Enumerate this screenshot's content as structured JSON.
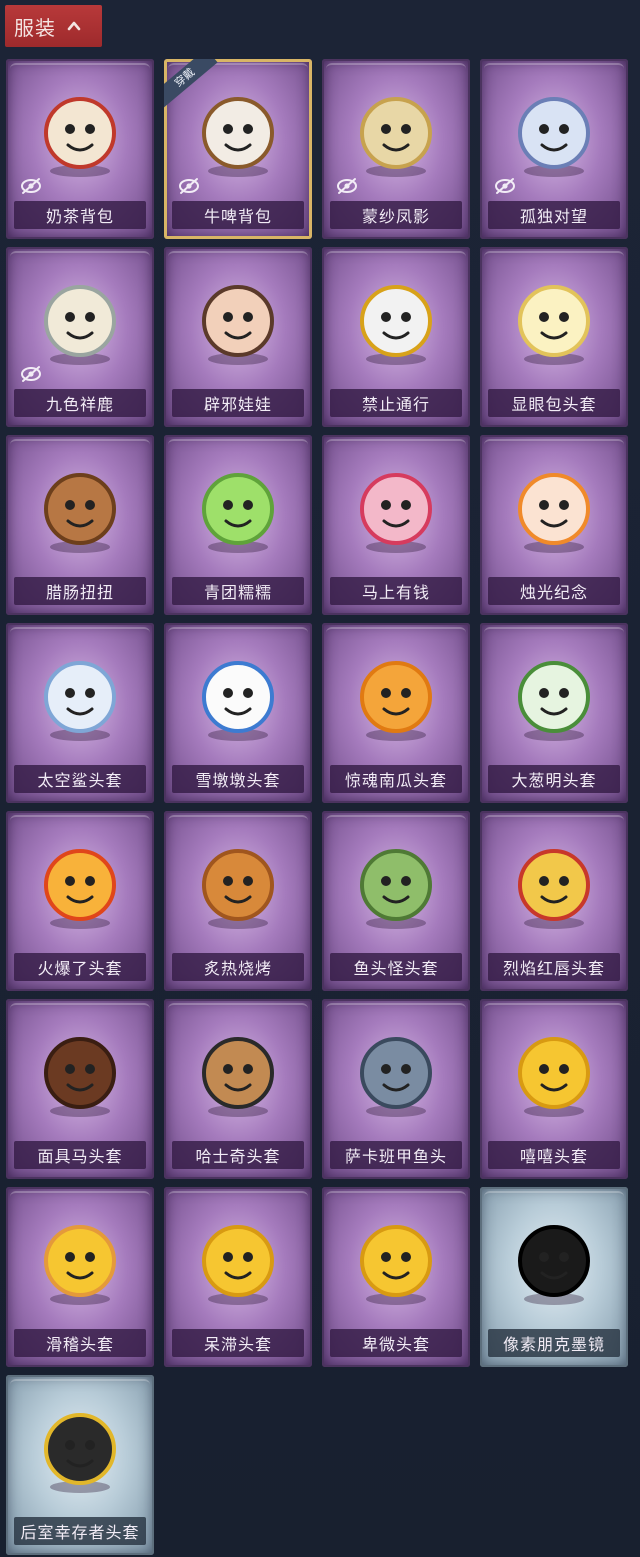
{
  "section": {
    "title": "服装"
  },
  "colors": {
    "header": "#b8393a",
    "card_purple": "#a57bbd",
    "card_blue": "#b8ccd8",
    "equipped_border": "#d8b566"
  },
  "items": [
    {
      "label": "奶茶背包",
      "hidden": true,
      "badge": "",
      "theme": "purple",
      "icon": "milk-tea-backpack-icon"
    },
    {
      "label": "牛啤背包",
      "hidden": true,
      "badge": "穿戴",
      "theme": "purple",
      "icon": "beer-barrel-backpack-icon"
    },
    {
      "label": "蒙纱凤影",
      "hidden": true,
      "badge": "",
      "theme": "purple",
      "icon": "veiled-phoenix-icon"
    },
    {
      "label": "孤独对望",
      "hidden": true,
      "badge": "",
      "theme": "purple",
      "icon": "lonely-gaze-icon"
    },
    {
      "label": "九色祥鹿",
      "hidden": true,
      "badge": "",
      "theme": "purple",
      "icon": "nine-color-deer-icon"
    },
    {
      "label": "辟邪娃娃",
      "hidden": false,
      "badge": "",
      "theme": "purple",
      "icon": "doll-head-icon"
    },
    {
      "label": "禁止通行",
      "hidden": false,
      "badge": "",
      "theme": "purple",
      "icon": "no-entry-cone-icon"
    },
    {
      "label": "显眼包头套",
      "hidden": false,
      "badge": "",
      "theme": "purple",
      "icon": "lightbulb-head-icon"
    },
    {
      "label": "腊肠扭扭",
      "hidden": false,
      "badge": "",
      "theme": "purple",
      "icon": "sausage-dog-icon"
    },
    {
      "label": "青团糯糯",
      "hidden": false,
      "badge": "",
      "theme": "purple",
      "icon": "green-dumpling-icon"
    },
    {
      "label": "马上有钱",
      "hidden": false,
      "badge": "",
      "theme": "purple",
      "icon": "pink-horse-icon"
    },
    {
      "label": "烛光纪念",
      "hidden": false,
      "badge": "",
      "theme": "purple",
      "icon": "candle-head-icon"
    },
    {
      "label": "太空鲨头套",
      "hidden": false,
      "badge": "",
      "theme": "purple",
      "icon": "space-shark-icon"
    },
    {
      "label": "雪墩墩头套",
      "hidden": false,
      "badge": "",
      "theme": "purple",
      "icon": "snowman-head-icon"
    },
    {
      "label": "惊魂南瓜头套",
      "hidden": false,
      "badge": "",
      "theme": "purple",
      "icon": "pumpkin-head-icon"
    },
    {
      "label": "大葱明头套",
      "hidden": false,
      "badge": "",
      "theme": "purple",
      "icon": "scallion-head-icon"
    },
    {
      "label": "火爆了头套",
      "hidden": false,
      "badge": "",
      "theme": "purple",
      "icon": "fireball-head-icon"
    },
    {
      "label": "炙热烧烤",
      "hidden": false,
      "badge": "",
      "theme": "purple",
      "icon": "bbq-meat-icon"
    },
    {
      "label": "鱼头怪头套",
      "hidden": false,
      "badge": "",
      "theme": "purple",
      "icon": "fish-head-icon"
    },
    {
      "label": "烈焰红唇头套",
      "hidden": false,
      "badge": "",
      "theme": "purple",
      "icon": "red-lips-head-icon"
    },
    {
      "label": "面具马头套",
      "hidden": false,
      "badge": "",
      "theme": "purple",
      "icon": "horse-mask-icon"
    },
    {
      "label": "哈士奇头套",
      "hidden": false,
      "badge": "",
      "theme": "purple",
      "icon": "husky-head-icon"
    },
    {
      "label": "萨卡班甲鱼头",
      "hidden": false,
      "badge": "",
      "theme": "purple",
      "icon": "sacabambaspis-icon"
    },
    {
      "label": "嘻嘻头套",
      "hidden": false,
      "badge": "",
      "theme": "purple",
      "icon": "grin-emoji-icon"
    },
    {
      "label": "滑稽头套",
      "hidden": false,
      "badge": "",
      "theme": "purple",
      "icon": "funny-emoji-icon"
    },
    {
      "label": "呆滞头套",
      "hidden": false,
      "badge": "",
      "theme": "purple",
      "icon": "dazed-emoji-icon"
    },
    {
      "label": "卑微头套",
      "hidden": false,
      "badge": "",
      "theme": "purple",
      "icon": "humble-emoji-icon"
    },
    {
      "label": "像素朋克墨镜",
      "hidden": false,
      "badge": "",
      "theme": "blue",
      "icon": "pixel-sunglasses-icon"
    },
    {
      "label": "后室幸存者头套",
      "hidden": false,
      "badge": "",
      "theme": "blue",
      "icon": "gas-mask-helmet-icon"
    }
  ]
}
